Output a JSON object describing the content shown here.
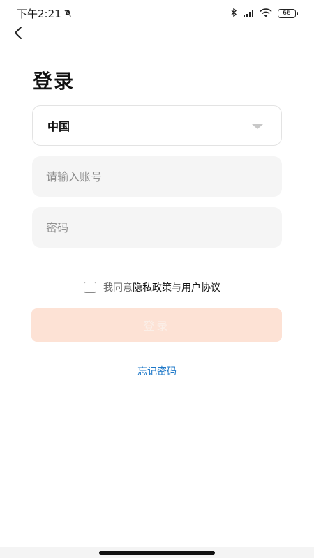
{
  "status_bar": {
    "time": "下午2:21",
    "battery": "66",
    "icons": [
      "mute-bell-icon",
      "bluetooth-icon",
      "signal-icon",
      "wifi-icon",
      "battery-icon"
    ]
  },
  "header": {
    "back_icon": "chevron-left-icon"
  },
  "title": "登录",
  "country_select": {
    "value": "中国",
    "icon": "caret-down-icon"
  },
  "account_field": {
    "placeholder": "请输入账号",
    "value": ""
  },
  "password_field": {
    "placeholder": "密码",
    "value": ""
  },
  "agreement": {
    "checked": false,
    "prefix": "我同意",
    "privacy_link": "隐私政策",
    "joiner": "与",
    "terms_link": "用户协议"
  },
  "login_button": {
    "label": "登录",
    "color": "#fde2d5"
  },
  "forgot_password": {
    "label": "忘记密码",
    "color": "#1e78c8"
  }
}
